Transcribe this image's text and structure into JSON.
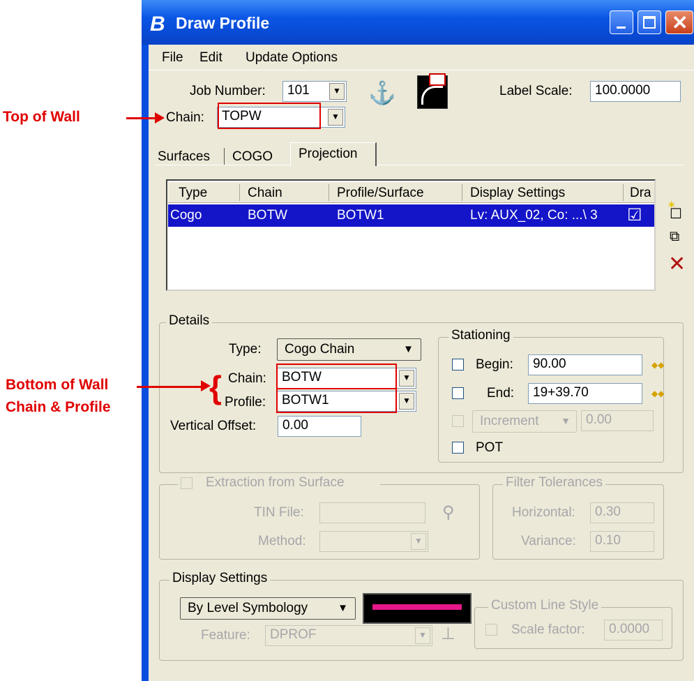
{
  "window": {
    "title": "Draw Profile"
  },
  "menu": [
    "File",
    "Edit",
    "Update Options"
  ],
  "header": {
    "job_number_label": "Job Number:",
    "job_number_value": "101",
    "chain_label": "Chain:",
    "chain_value": "TOPW",
    "label_scale_label": "Label Scale:",
    "label_scale_value": "100.0000"
  },
  "tabs": [
    "Surfaces",
    "COGO",
    "Projection"
  ],
  "table": {
    "columns": [
      "Type",
      "Chain",
      "Profile/Surface",
      "Display Settings",
      "Dra"
    ],
    "rows": [
      {
        "type": "Cogo",
        "chain": "BOTW",
        "profile": "BOTW1",
        "display": "Lv: AUX_02, Co: ...\\ 3",
        "draw": "☑"
      }
    ]
  },
  "details": {
    "title": "Details",
    "type_label": "Type:",
    "type_value": "Cogo Chain",
    "chain_label": "Chain:",
    "chain_value": "BOTW",
    "profile_label": "Profile:",
    "profile_value": "BOTW1",
    "vertical_offset_label": "Vertical Offset:",
    "vertical_offset_value": "0.00"
  },
  "stationing": {
    "title": "Stationing",
    "begin_label": "Begin:",
    "begin_value": "90.00",
    "end_label": "End:",
    "end_value": "19+39.70",
    "increment_label": "Increment",
    "increment_value": "0.00",
    "pot_label": "POT"
  },
  "extraction": {
    "title": "Extraction from Surface",
    "tin_label": "TIN File:",
    "method_label": "Method:"
  },
  "filter": {
    "title": "Filter Tolerances",
    "horizontal_label": "Horizontal:",
    "horizontal_value": "0.30",
    "variance_label": "Variance:",
    "variance_value": "0.10"
  },
  "display": {
    "title": "Display Settings",
    "symbology": "By Level Symbology",
    "feature_label": "Feature:",
    "feature_value": "DPROF",
    "custom_title": "Custom Line Style",
    "scale_label": "Scale factor:",
    "scale_value": "0.0000",
    "line_color": "#e8178a"
  },
  "annotations": {
    "top_of_wall": "Top of Wall",
    "bottom_line1": "Bottom of Wall",
    "bottom_line2": "Chain & Profile"
  }
}
